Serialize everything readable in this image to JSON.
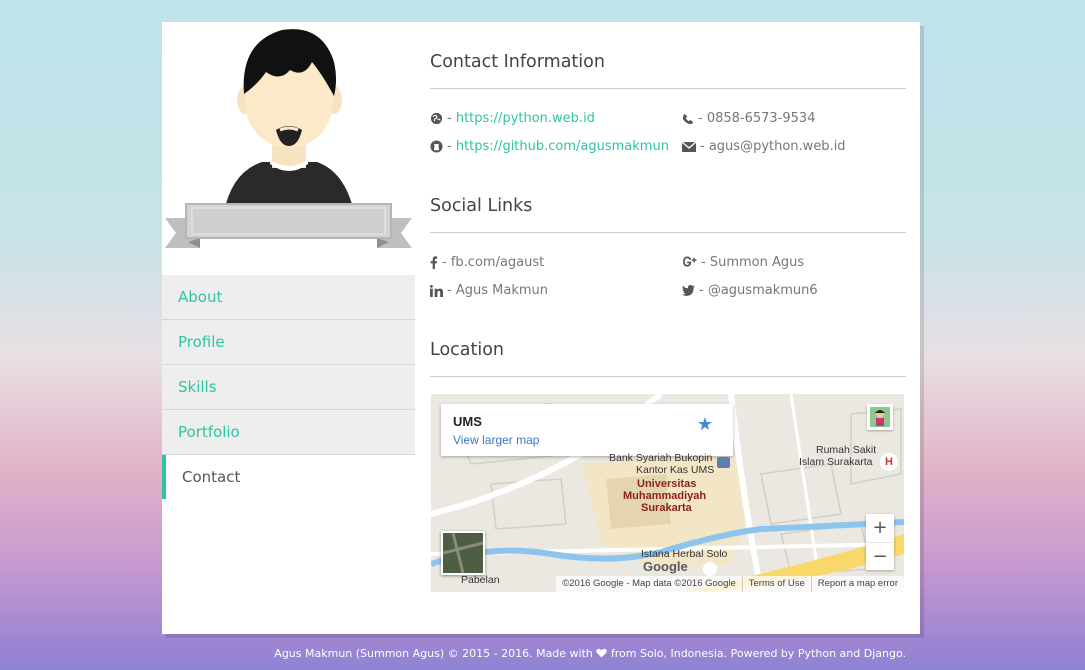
{
  "nav": {
    "items": [
      {
        "label": "About"
      },
      {
        "label": "Profile"
      },
      {
        "label": "Skills"
      },
      {
        "label": "Portfolio"
      },
      {
        "label": "Contact",
        "active": true
      }
    ]
  },
  "contact": {
    "title": "Contact Information",
    "website": "https://python.web.id",
    "github": "https://github.com/agusmakmun",
    "phone": "0858-6573-9534",
    "email": "agus@python.web.id",
    "separator": "-"
  },
  "social": {
    "title": "Social Links",
    "facebook": "fb.com/agaust",
    "google_plus": "Summon Agus",
    "linkedin": "Agus Makmun",
    "twitter": "@agusmakmun6"
  },
  "location": {
    "title": "Location",
    "map": {
      "place_name": "UMS",
      "larger_map_link": "View larger map",
      "labels": {
        "bank": "Bank Syariah Bukopin",
        "kantor": "Kantor Kas UMS",
        "univ_1": "Universitas",
        "univ_2": "Muhammadiyah",
        "univ_3": "Surakarta",
        "hospital_1": "Rumah Sakit",
        "hospital_2": "Islam Surakarta",
        "istana": "Istana Herbal Solo",
        "pabelan": "Pabelan",
        "google": "Google"
      },
      "zoom_in": "+",
      "zoom_out": "−",
      "attribution": "©2016 Google - Map data ©2016 Google",
      "terms": "Terms of Use",
      "report": "Report a map error"
    }
  },
  "footer": {
    "prefix": "Agus Makmun (Summon Agus) © 2015 - 2016. Made with",
    "suffix": "from Solo, Indonesia. Powered by Python and Django."
  },
  "colors": {
    "accent": "#2ec4a3",
    "link_blue": "#3a78c9"
  }
}
